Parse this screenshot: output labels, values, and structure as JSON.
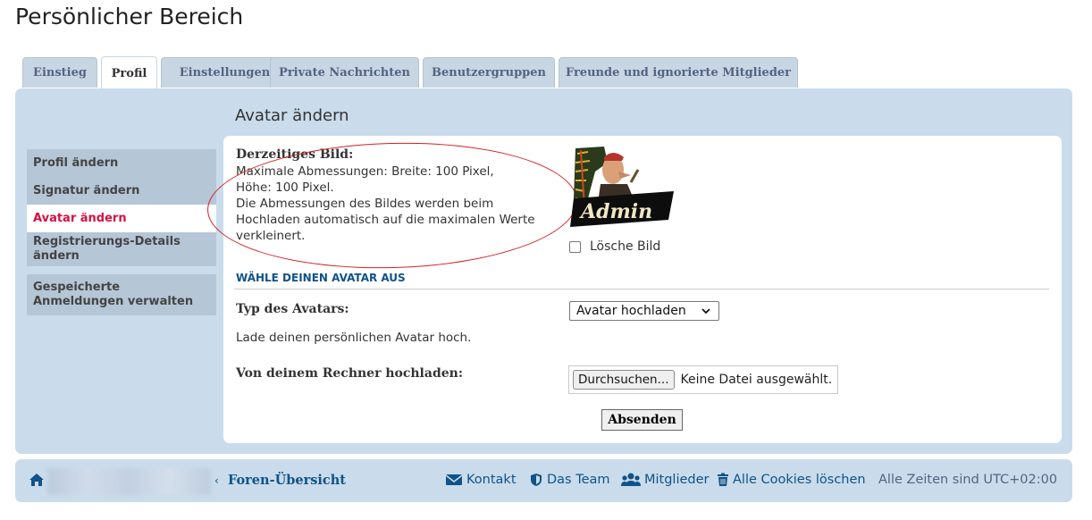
{
  "page": {
    "title": "Persönlicher Bereich"
  },
  "tabs": [
    {
      "label": "Einstieg",
      "active": false
    },
    {
      "label": "Profil",
      "active": true
    },
    {
      "label": "Einstellungen",
      "active": false
    },
    {
      "label": "Private Nachrichten",
      "active": false
    },
    {
      "label": "Benutzergruppen",
      "active": false
    },
    {
      "label": "Freunde und ignorierte Mitglieder",
      "active": false
    }
  ],
  "sidebar": {
    "items": [
      {
        "label": "Profil ändern",
        "active": false
      },
      {
        "label": "Signatur ändern",
        "active": false
      },
      {
        "label": "Avatar ändern",
        "active": true
      },
      {
        "label": "Registrierungs-Details ändern",
        "active": false
      },
      {
        "label": "Gespeicherte Anmeldungen verwalten",
        "active": false
      }
    ]
  },
  "main": {
    "section_title": "Avatar ändern",
    "current_image_label": "Derzeitiges Bild:",
    "current_image_lines": [
      "Maximale Abmessungen: Breite: 100 Pixel,",
      "Höhe: 100 Pixel.",
      "Die Abmessungen des Bildes werden beim",
      "Hochladen automatisch auf die maximalen Werte",
      "verkleinert."
    ],
    "avatar_text": "Admin",
    "delete_label": "Lösche Bild",
    "choose_header": "WÄHLE DEINEN AVATAR AUS",
    "avatar_type_label": "Typ des Avatars:",
    "avatar_type_value": "Avatar hochladen",
    "upload_hint": "Lade deinen persönlichen Avatar hoch.",
    "upload_label": "Von deinem Rechner hochladen:",
    "browse_button": "Durchsuchen...",
    "file_status": "Keine Datei ausgewählt.",
    "submit_button": "Absenden"
  },
  "footer": {
    "breadcrumb_link": "Foren-Übersicht",
    "contact": "Kontakt",
    "team": "Das Team",
    "members": "Mitglieder",
    "delete_cookies": "Alle Cookies löschen",
    "timezone": "Alle Zeiten sind UTC+02:00"
  },
  "colors": {
    "accent": "#105289",
    "panel": "#cadceb",
    "active_menu": "#d31141",
    "annotation": "#d42020"
  },
  "icons": [
    "home-icon",
    "envelope-icon",
    "shield-icon",
    "users-icon",
    "trash-icon",
    "chevron-down-icon"
  ]
}
